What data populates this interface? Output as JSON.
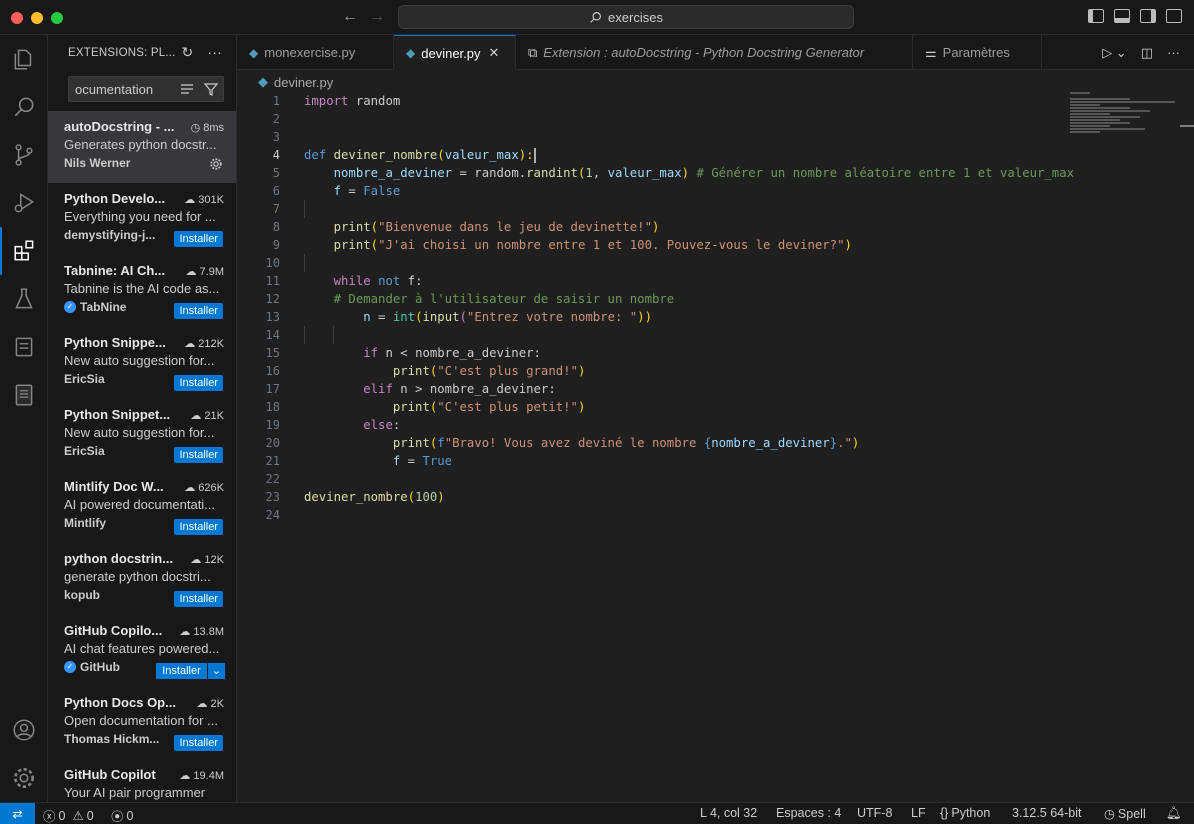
{
  "titlebar": {
    "search_text": "exercises"
  },
  "sidebar": {
    "title": "EXTENSIONS: PL...",
    "search_value": "ocumentation",
    "extensions": [
      {
        "name": "autoDocstring - ...",
        "meta": "8ms",
        "meta_icon": "history-icon",
        "desc": "Generates python docstr...",
        "publisher": "Nils Werner",
        "action": "gear",
        "verified": false
      },
      {
        "name": "Python Develo...",
        "meta": "301K",
        "meta_icon": "cloud-download-icon",
        "desc": "Everything you need for ...",
        "publisher": "demystifying-j...",
        "action": "Installer",
        "verified": false
      },
      {
        "name": "Tabnine: AI Ch...",
        "meta": "7.9M",
        "meta_icon": "cloud-download-icon",
        "desc": "Tabnine is the AI code as...",
        "publisher": "TabNine",
        "action": "Installer",
        "verified": true
      },
      {
        "name": "Python Snippe...",
        "meta": "212K",
        "meta_icon": "cloud-download-icon",
        "desc": "New auto suggestion for...",
        "publisher": "EricSia",
        "action": "Installer",
        "verified": false
      },
      {
        "name": "Python Snippet...",
        "meta": "21K",
        "meta_icon": "cloud-download-icon",
        "desc": "New auto suggestion for...",
        "publisher": "EricSia",
        "action": "Installer",
        "verified": false
      },
      {
        "name": "Mintlify Doc W...",
        "meta": "626K",
        "meta_icon": "cloud-download-icon",
        "desc": "AI powered documentati...",
        "publisher": "Mintlify",
        "action": "Installer",
        "verified": false
      },
      {
        "name": "python docstrin...",
        "meta": "12K",
        "meta_icon": "cloud-download-icon",
        "desc": "generate python docstri...",
        "publisher": "kopub",
        "action": "Installer",
        "verified": false
      },
      {
        "name": "GitHub Copilo...",
        "meta": "13.8M",
        "meta_icon": "cloud-download-icon",
        "desc": "AI chat features powered...",
        "publisher": "GitHub",
        "action": "Installer-split",
        "verified": true
      },
      {
        "name": "Python Docs Op...",
        "meta": "2K",
        "meta_icon": "cloud-download-icon",
        "desc": "Open documentation for ...",
        "publisher": "Thomas Hickm...",
        "action": "Installer",
        "verified": false
      },
      {
        "name": "GitHub Copilot",
        "meta": "19.4M",
        "meta_icon": "cloud-download-icon",
        "desc": "Your AI pair programmer",
        "publisher": "",
        "action": "",
        "verified": false
      }
    ]
  },
  "tabs": [
    {
      "label": "monexercise.py",
      "icon": "python-file-icon"
    },
    {
      "label": "deviner.py",
      "icon": "python-file-icon",
      "active": true
    },
    {
      "label": "Extension : autoDocstring - Python Docstring Generator",
      "icon": "extension-icon"
    },
    {
      "label": "Paramètres",
      "icon": "settings-icon"
    }
  ],
  "breadcrumb": {
    "file": "deviner.py"
  },
  "editor": {
    "line_numbers": [
      "1",
      "2",
      "3",
      "4",
      "5",
      "6",
      "7",
      "8",
      "9",
      "10",
      "11",
      "12",
      "13",
      "14",
      "15",
      "16",
      "17",
      "18",
      "19",
      "20",
      "21",
      "22",
      "23",
      "24"
    ],
    "current_line": "4"
  },
  "code": {
    "l1_kw": "import",
    "l1_rest": " random",
    "l4_def": "def",
    "l4_fn": "deviner_nombre",
    "l4_p1": "(",
    "l4_param": "valeur_max",
    "l4_p2": "):",
    "l5_var": "nombre_a_deviner",
    "l5_eq": " = random.",
    "l5_fn": "randint",
    "l5_p1": "(",
    "l5_num": "1",
    "l5_comma": ", ",
    "l5_var2": "valeur_max",
    "l5_p2": ")",
    "l5_com": " # Générer un nombre aléatoire entre 1 et valeur_max",
    "l6_var": "f",
    "l6_eq": " = ",
    "l6_kw": "False",
    "l8_fn": "print",
    "l8_p1": "(",
    "l8_str": "\"Bienvenue dans le jeu de devinette!\"",
    "l8_p2": ")",
    "l9_fn": "print",
    "l9_p1": "(",
    "l9_str": "\"J'ai choisi un nombre entre 1 et 100. Pouvez-vous le deviner?\"",
    "l9_p2": ")",
    "l11_kw": "while",
    "l11_sp": " ",
    "l11_not": "not",
    "l11_rest": " f:",
    "l12_com": "# Demander à l'utilisateur de saisir un nombre",
    "l13_var": "n",
    "l13_eq": " = ",
    "l13_bi": "int",
    "l13_p1": "(",
    "l13_fn": "input",
    "l13_p2": "(",
    "l13_str": "\"Entrez votre nombre: \"",
    "l13_p3": "))",
    "l15_kw": "if",
    "l15_rest": " n < nombre_a_deviner:",
    "l16_fn": "print",
    "l16_p1": "(",
    "l16_str": "\"C'est plus grand!\"",
    "l16_p2": ")",
    "l17_kw": "elif",
    "l17_rest": " n > nombre_a_deviner:",
    "l18_fn": "print",
    "l18_p1": "(",
    "l18_str": "\"C'est plus petit!\"",
    "l18_p2": ")",
    "l19_kw": "else",
    "l19_rest": ":",
    "l20_fn": "print",
    "l20_p1": "(",
    "l20_kw": "f",
    "l20_str1": "\"Bravo! Vous avez deviné le nombre ",
    "l20_b1": "{",
    "l20_var": "nombre_a_deviner",
    "l20_b2": "}",
    "l20_str2": ".\"",
    "l20_p2": ")",
    "l21_var": "f",
    "l21_eq": " = ",
    "l21_kw": "True",
    "l23_fn": "deviner_nombre",
    "l23_p1": "(",
    "l23_num": "100",
    "l23_p2": ")"
  },
  "statusbar": {
    "errors": "0",
    "warnings": "0",
    "ports": "0",
    "position": "L 4, col 32",
    "spaces": "Espaces : 4",
    "encoding": "UTF-8",
    "eol": "LF",
    "language": "Python",
    "interpreter": "3.12.5 64-bit",
    "spell": "Spell"
  },
  "colors": {
    "accent": "#0078d4",
    "install_button": "#0078d4"
  }
}
